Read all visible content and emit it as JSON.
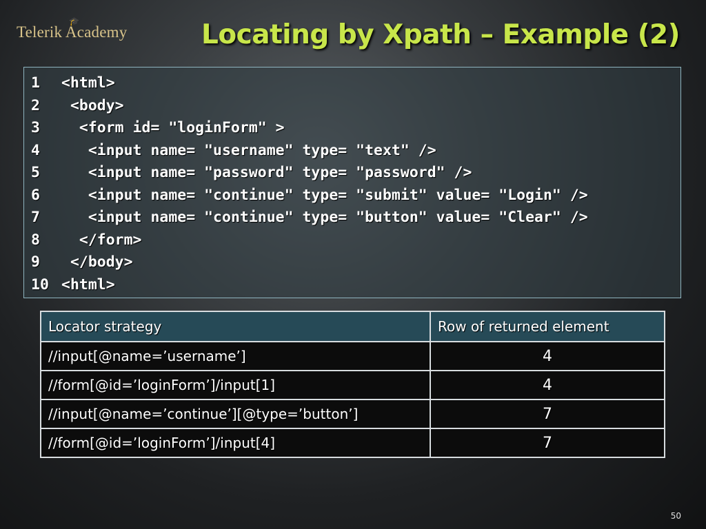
{
  "logo": {
    "text": "Telerik Academy"
  },
  "title": "Locating by Xpath – Example (2)",
  "code": [
    {
      "num": "1",
      "text": "<html>"
    },
    {
      "num": "2",
      "text": " <body>"
    },
    {
      "num": "3",
      "text": "  <form id= \"loginForm\" >"
    },
    {
      "num": "4",
      "text": "   <input name= \"username\" type= \"text\" />"
    },
    {
      "num": "5",
      "text": "   <input name= \"password\" type= \"password\" />"
    },
    {
      "num": "6",
      "text": "   <input name= \"continue\" type= \"submit\" value= \"Login\" />"
    },
    {
      "num": "7",
      "text": "   <input name= \"continue\" type= \"button\" value= \"Clear\" />"
    },
    {
      "num": "8",
      "text": "  </form>"
    },
    {
      "num": "9",
      "text": " </body>"
    },
    {
      "num": "10",
      "text": "<html>"
    }
  ],
  "table": {
    "headers": [
      "Locator strategy",
      "Row of returned element"
    ],
    "rows": [
      {
        "strategy": "//input[@name=’username’]",
        "row": "4"
      },
      {
        "strategy": "//form[@id=’loginForm’]/input[1]",
        "row": "4"
      },
      {
        "strategy": "//input[@name=’continue’][@type=’button’]",
        "row": "7"
      },
      {
        "strategy": "//form[@id=’loginForm’]/input[4]",
        "row": "7"
      }
    ]
  },
  "page_number": "50",
  "colors": {
    "title": "#c8e64a",
    "logo": "#d9c48a",
    "table_header": "#264a57"
  }
}
